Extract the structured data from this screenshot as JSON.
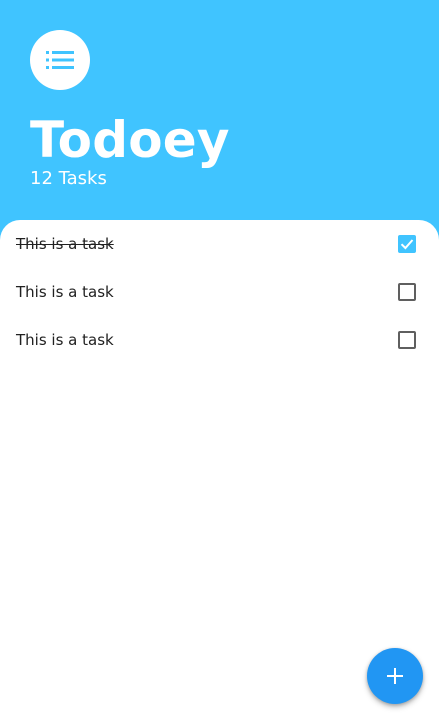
{
  "colors": {
    "accent": "#40c4ff",
    "fab": "#2196f3",
    "background": "#ffffff",
    "text": "#212121"
  },
  "header": {
    "icon": "list-icon",
    "title": "Todoey",
    "task_count": "12 Tasks"
  },
  "tasks": [
    {
      "label": "This is a task",
      "done": true
    },
    {
      "label": "This is a task",
      "done": false
    },
    {
      "label": "This is a task",
      "done": false
    }
  ],
  "fab": {
    "icon": "plus-icon"
  }
}
